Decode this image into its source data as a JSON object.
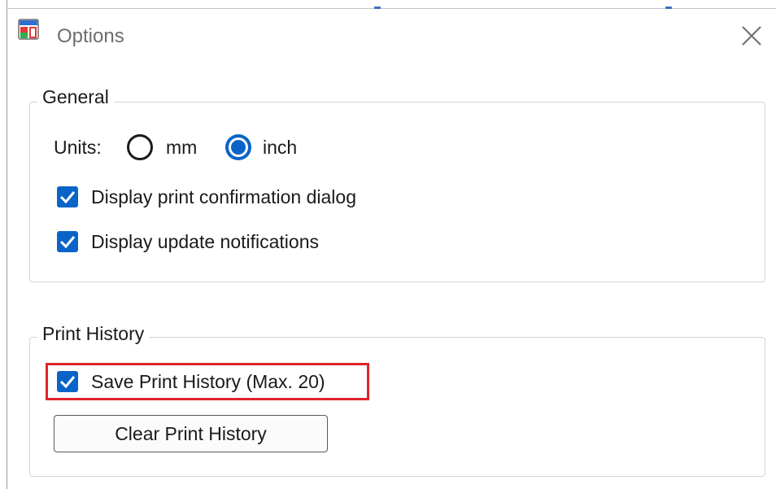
{
  "window": {
    "title": "Options",
    "app_icon": "app-logo-icon",
    "close_icon": "close-icon"
  },
  "general": {
    "legend": "General",
    "units_label": "Units:",
    "units_options": [
      {
        "label": "mm",
        "selected": false
      },
      {
        "label": "inch",
        "selected": true
      }
    ],
    "checkboxes": [
      {
        "label": "Display print confirmation dialog",
        "checked": true
      },
      {
        "label": "Display update notifications",
        "checked": true
      }
    ]
  },
  "print_history": {
    "legend": "Print History",
    "save_history": {
      "label": "Save Print History (Max. 20)",
      "checked": true
    },
    "clear_button": "Clear Print History"
  },
  "colors": {
    "accent": "#0a64c8",
    "highlight": "#e0242b",
    "border": "#cfd6dd"
  }
}
